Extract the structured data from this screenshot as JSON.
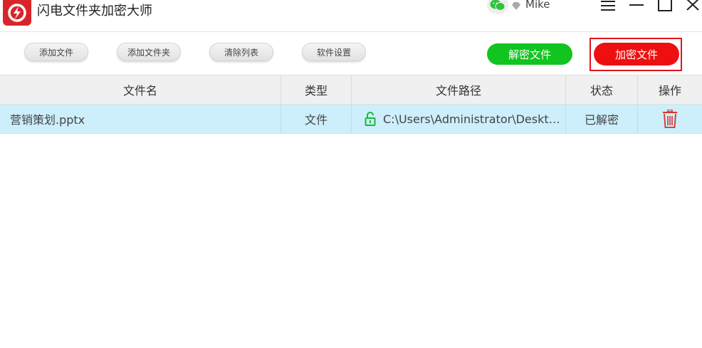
{
  "app": {
    "title": "闪电文件夹加密大师",
    "user_name": "Mike"
  },
  "colors": {
    "brand_red": "#d9252a",
    "decrypt_green": "#12c41f",
    "encrypt_red": "#ee1010",
    "row_selected": "#cdeefb",
    "lock_green": "#19b839",
    "trash_red": "#d8322c"
  },
  "icons": {
    "logo": "lightning-lock-logo",
    "wechat": "wechat-icon",
    "vip": "diamond-icon",
    "menu": "hamburger-menu-icon",
    "minimize": "minimize-icon",
    "maximize": "maximize-icon",
    "close": "close-icon",
    "lock": "unlocked-padlock-icon",
    "delete": "trash-icon"
  },
  "toolbar": {
    "add_file": "添加文件",
    "add_folder": "添加文件夹",
    "clear_list": "清除列表",
    "settings": "软件设置",
    "decrypt": "解密文件",
    "encrypt": "加密文件"
  },
  "table": {
    "headers": {
      "name": "文件名",
      "type": "类型",
      "path": "文件路径",
      "status": "状态",
      "action": "操作"
    },
    "rows": [
      {
        "name": "营销策划.pptx",
        "type": "文件",
        "path": "C:\\Users\\Administrator\\Deskto...",
        "status": "已解密"
      }
    ]
  }
}
